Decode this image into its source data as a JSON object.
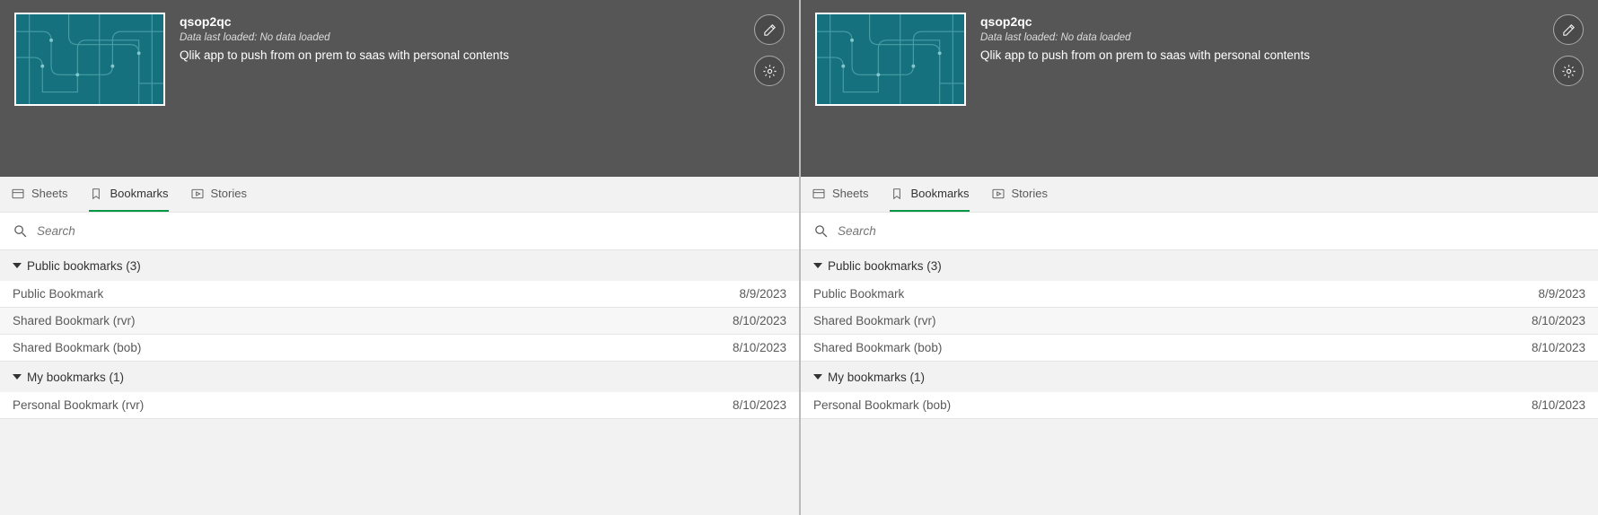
{
  "panes": [
    {
      "header": {
        "title": "qsop2qc",
        "data_loaded": "Data last loaded: No data loaded",
        "description": "Qlik app to push from on prem to saas with personal contents"
      },
      "tabs": {
        "sheets": "Sheets",
        "bookmarks": "Bookmarks",
        "stories": "Stories",
        "active": "bookmarks"
      },
      "search": {
        "placeholder": "Search"
      },
      "sections": [
        {
          "title": "Public bookmarks (3)",
          "items": [
            {
              "name": "Public Bookmark",
              "date": "8/9/2023"
            },
            {
              "name": "Shared Bookmark (rvr)",
              "date": "8/10/2023"
            },
            {
              "name": "Shared Bookmark (bob)",
              "date": "8/10/2023"
            }
          ]
        },
        {
          "title": "My bookmarks (1)",
          "items": [
            {
              "name": "Personal Bookmark (rvr)",
              "date": "8/10/2023"
            }
          ]
        }
      ]
    },
    {
      "header": {
        "title": "qsop2qc",
        "data_loaded": "Data last loaded: No data loaded",
        "description": "Qlik app to push from on prem to saas with personal contents"
      },
      "tabs": {
        "sheets": "Sheets",
        "bookmarks": "Bookmarks",
        "stories": "Stories",
        "active": "bookmarks"
      },
      "search": {
        "placeholder": "Search"
      },
      "sections": [
        {
          "title": "Public bookmarks (3)",
          "items": [
            {
              "name": "Public Bookmark",
              "date": "8/9/2023"
            },
            {
              "name": "Shared Bookmark (rvr)",
              "date": "8/10/2023"
            },
            {
              "name": "Shared Bookmark (bob)",
              "date": "8/10/2023"
            }
          ]
        },
        {
          "title": "My bookmarks (1)",
          "items": [
            {
              "name": "Personal Bookmark (bob)",
              "date": "8/10/2023"
            }
          ]
        }
      ]
    }
  ]
}
